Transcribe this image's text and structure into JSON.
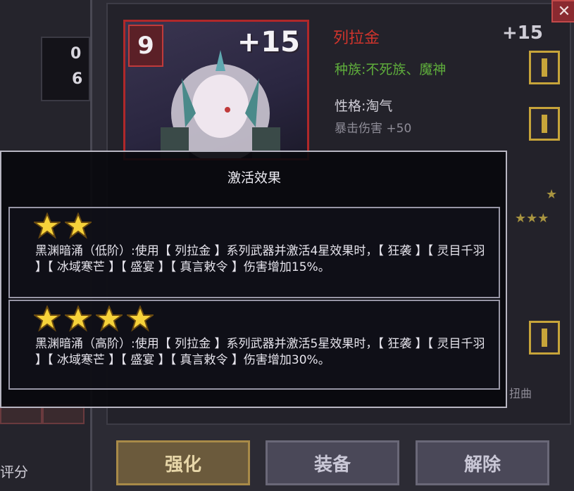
{
  "background": {
    "stat_values": [
      "0",
      "6"
    ],
    "score_label": "评分"
  },
  "card": {
    "level": "9",
    "plus": "+15"
  },
  "hero": {
    "name": "列拉金",
    "plus": "+15",
    "race": "种族:不死族、魔神",
    "personality": "性格:淘气",
    "crit": "暴击伤害 +50",
    "side_faint": "扭曲"
  },
  "buttons": {
    "strengthen": "强化",
    "equip": "装备",
    "release": "解除",
    "close": "✕"
  },
  "popup": {
    "title": "激活效果",
    "effects": [
      {
        "stars": 2,
        "text": "黑渊暗涌（低阶）:使用【 列拉金 】系列武器并激活4星效果时，【 狂袭 】【 灵目千羽 】【 冰域寒芒 】【 盛宴 】【 真言敕令 】伤害增加15%。"
      },
      {
        "stars": 4,
        "text": "黑渊暗涌（高阶）:使用【 列拉金 】系列武器并激活5星效果时，【 狂袭 】【 灵目千羽 】【 冰域寒芒 】【 盛宴 】【 真言敕令 】伤害增加30%。"
      }
    ]
  },
  "colors": {
    "name_red": "#d0342c",
    "race_green": "#5fae3c",
    "gold": "#c7a43a",
    "star_yellow": "#f6d23a"
  }
}
